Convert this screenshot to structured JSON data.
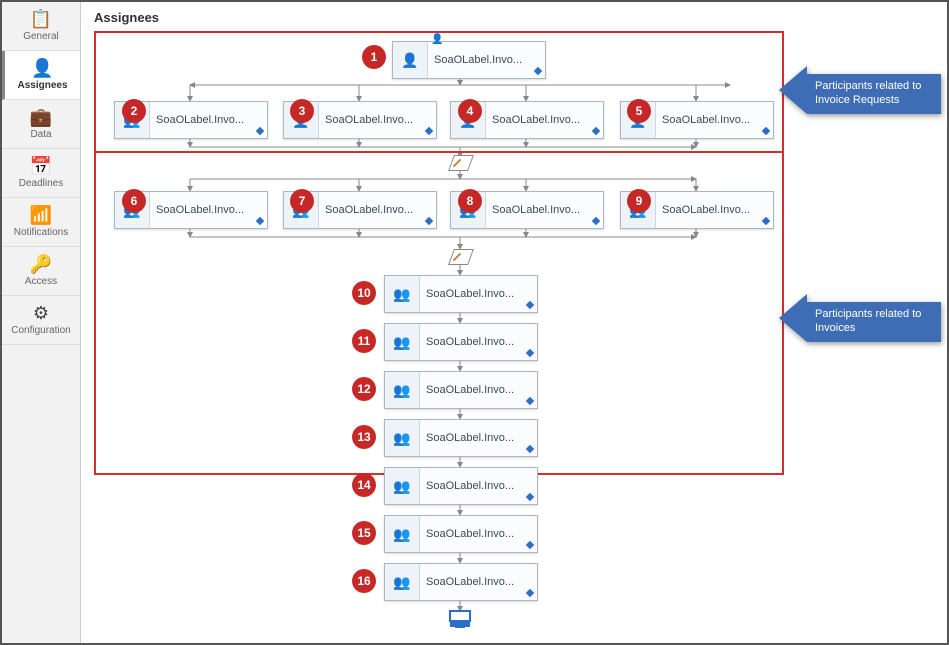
{
  "title": "Assignees",
  "sidebar": [
    {
      "icon": "📋",
      "label": "General",
      "name": "sidebar-item-general"
    },
    {
      "icon": "👤",
      "label": "Assignees",
      "name": "sidebar-item-assignees",
      "active": true
    },
    {
      "icon": "💼",
      "label": "Data",
      "name": "sidebar-item-data"
    },
    {
      "icon": "📅",
      "label": "Deadlines",
      "name": "sidebar-item-deadlines"
    },
    {
      "icon": "📶",
      "label": "Notifications",
      "name": "sidebar-item-notifications"
    },
    {
      "icon": "🔑",
      "label": "Access",
      "name": "sidebar-item-access"
    },
    {
      "icon": "⚙",
      "label": "Configuration",
      "name": "sidebar-item-configuration"
    }
  ],
  "blocks_label": "SoaOLabel.Invo...",
  "callouts": {
    "top": "Participants related to Invoice Requests",
    "bottom": "Participants related to Invoices"
  },
  "badge_count": 16,
  "icons": {
    "user_blue": "👤",
    "group": "👥",
    "user_grey": "👤"
  }
}
